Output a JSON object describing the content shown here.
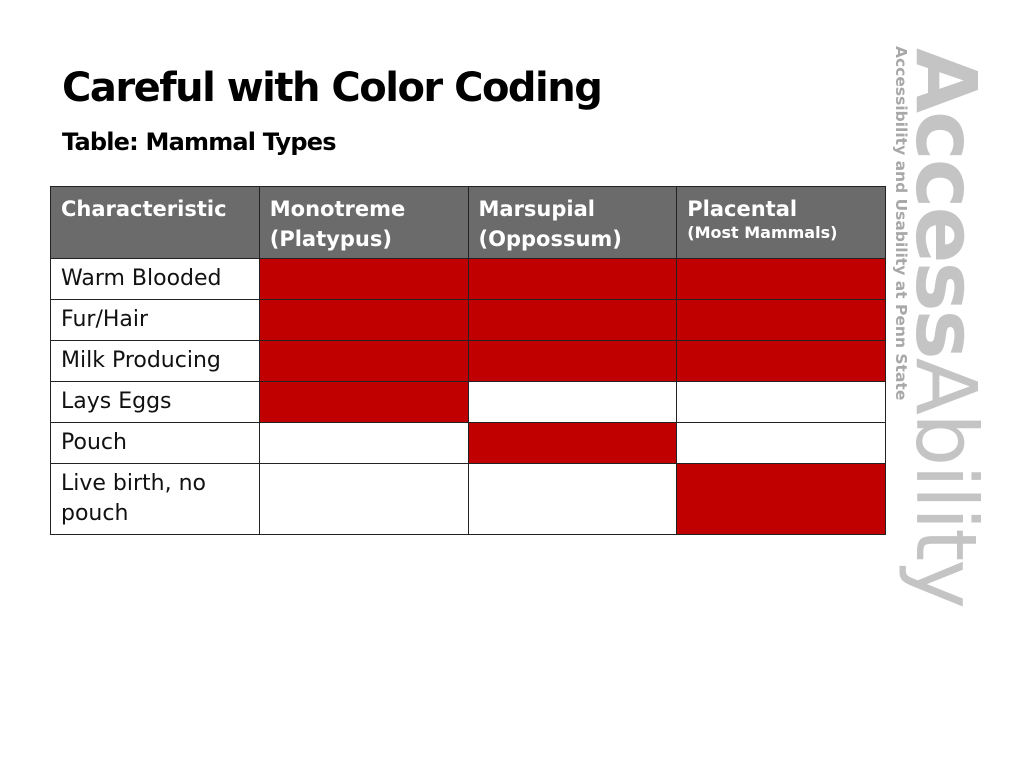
{
  "slide": {
    "title": "Careful with Color Coding",
    "subtitle": "Table: Mammal Types"
  },
  "colors": {
    "header_bg": "#6b6b6b",
    "present": "#c00000",
    "absent": "#ffffff"
  },
  "table": {
    "headers": [
      {
        "main": "Characteristic",
        "sub": ""
      },
      {
        "main": "Monotreme (Platypus)",
        "sub": ""
      },
      {
        "main": "Marsupial (Oppossum)",
        "sub": ""
      },
      {
        "main": "Placental",
        "sub": "(Most Mammals)"
      }
    ],
    "rows": [
      {
        "label": "Warm Blooded",
        "cells": [
          true,
          true,
          true
        ]
      },
      {
        "label": "Fur/Hair",
        "cells": [
          true,
          true,
          true
        ]
      },
      {
        "label": "Milk Producing",
        "cells": [
          true,
          true,
          true
        ]
      },
      {
        "label": "Lays Eggs",
        "cells": [
          true,
          false,
          false
        ]
      },
      {
        "label": "Pouch",
        "cells": [
          false,
          true,
          false
        ]
      },
      {
        "label": "Live birth, no pouch",
        "cells": [
          false,
          false,
          true
        ]
      }
    ]
  },
  "logo": {
    "bold_part": "Access",
    "light_part": "Ability",
    "tagline": "Accessibility and Usability at Penn State"
  }
}
